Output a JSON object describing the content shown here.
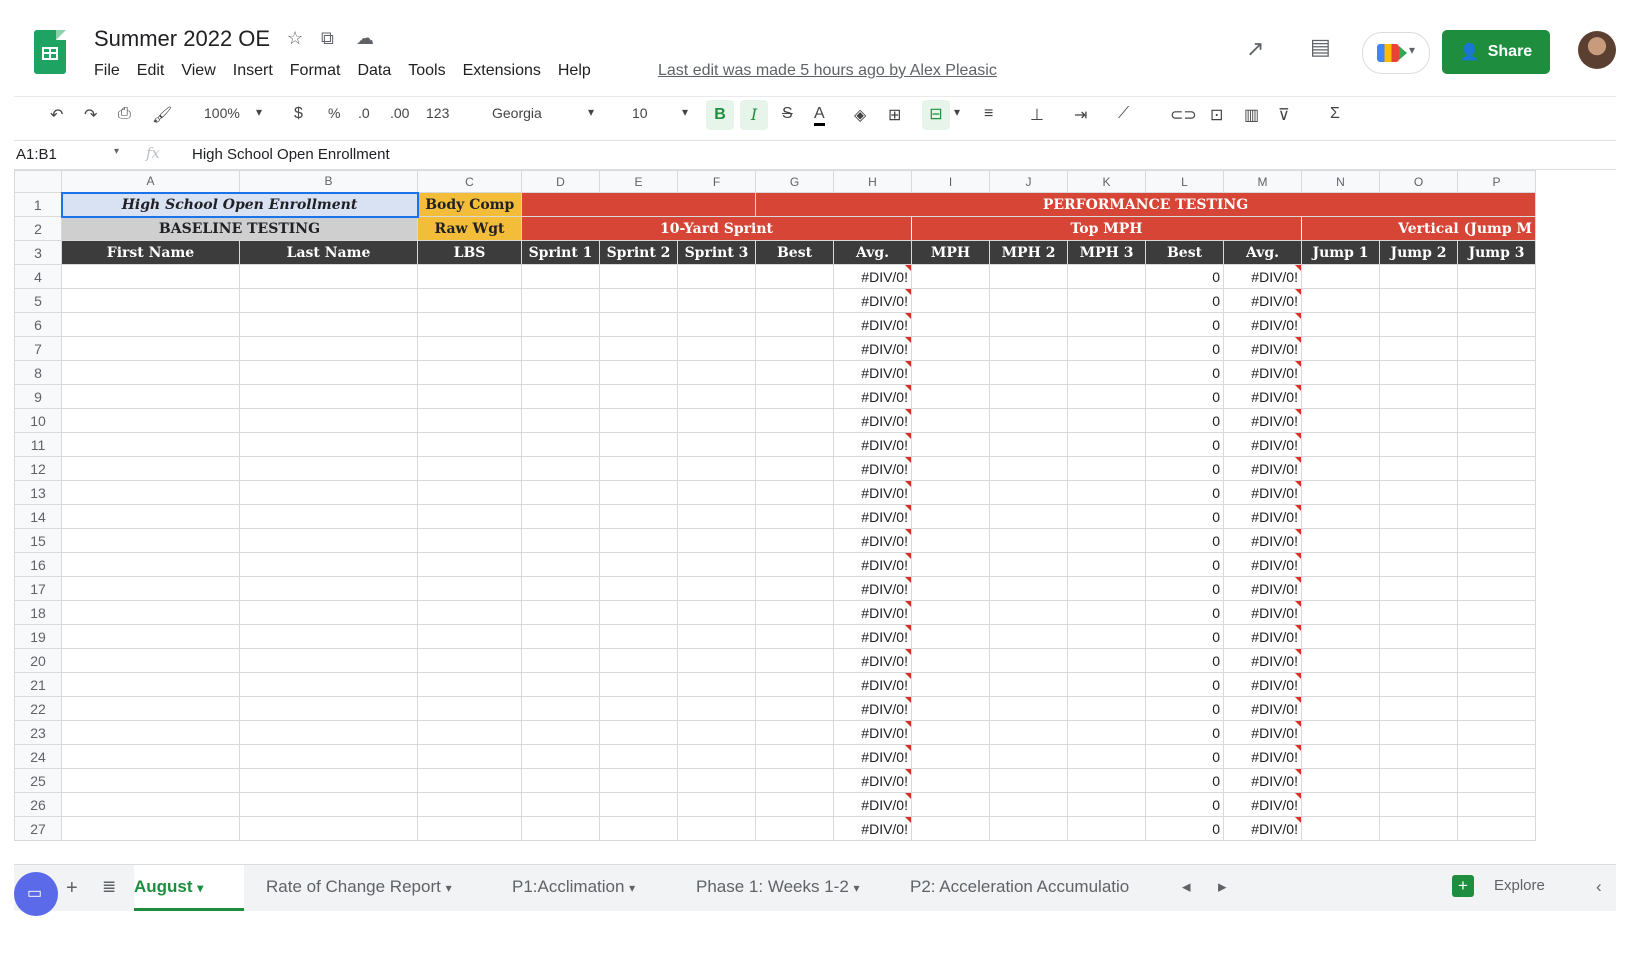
{
  "app": {
    "title": "Summer 2022 OE",
    "menu": [
      "File",
      "Edit",
      "View",
      "Insert",
      "Format",
      "Data",
      "Tools",
      "Extensions",
      "Help"
    ],
    "last_edit": "Last edit was made 5 hours ago by Alex Pleasic",
    "share_label": "Share"
  },
  "toolbar": {
    "zoom": "100%",
    "currency": "$",
    "percent": "%",
    "dec_decrease": ".0",
    "dec_increase": ".00",
    "format_more": "123",
    "font": "Georgia",
    "font_size": "10",
    "bold": "B",
    "italic": "I",
    "strike": "S",
    "text_color": "A"
  },
  "formula_bar": {
    "range": "A1:B1",
    "fx": "fx",
    "content": "High School Open Enrollment"
  },
  "columns": [
    "A",
    "B",
    "C",
    "D",
    "E",
    "F",
    "G",
    "H",
    "I",
    "J",
    "K",
    "L",
    "M",
    "N",
    "O",
    "P"
  ],
  "row1": {
    "a1": "High School Open Enrollment",
    "c1": "Body Comp",
    "perf": "PERFORMANCE TESTING"
  },
  "row2": {
    "a2": "BASELINE TESTING",
    "c2": "Raw Wgt",
    "sprint": "10-Yard Sprint",
    "topmph": "Top MPH",
    "vertical": "Vertical (Jump M"
  },
  "row3": [
    "First Name",
    "Last Name",
    "LBS",
    "Sprint 1",
    "Sprint 2",
    "Sprint 3",
    "Best",
    "Avg.",
    "MPH",
    "MPH 2",
    "MPH 3",
    "Best",
    "Avg.",
    "Jump 1",
    "Jump 2",
    "Jump 3"
  ],
  "data_rows": {
    "row_numbers": [
      "4",
      "5",
      "6",
      "7",
      "8",
      "9",
      "10",
      "11",
      "12",
      "13",
      "14",
      "15",
      "16",
      "17",
      "18",
      "19",
      "20",
      "21",
      "22",
      "23",
      "24",
      "25",
      "26",
      "27"
    ],
    "h_value": "#DIV/0!",
    "l_value": "0",
    "m_value": "#DIV/0!"
  },
  "sheet_tabs": [
    "August",
    "Rate of Change Report",
    "P1:Acclimation",
    "Phase 1: Weeks 1-2",
    "P2: Acceleration Accumulatio"
  ],
  "explore_label": "Explore",
  "colors": {
    "red": "#d64536",
    "yellow": "#f3bd3a",
    "dark": "#3c3c3c",
    "share": "#1e8e3e"
  }
}
